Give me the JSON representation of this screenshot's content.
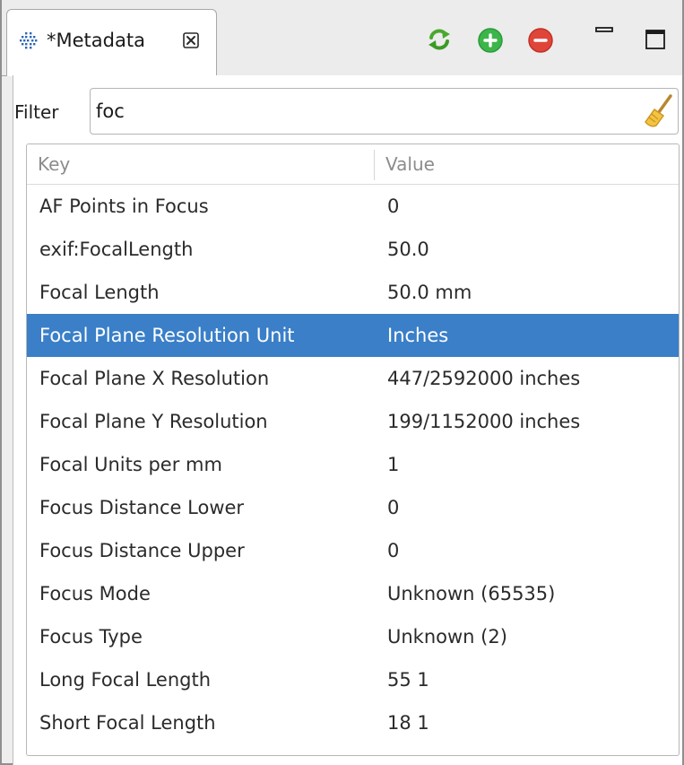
{
  "tab": {
    "title": "*Metadata",
    "icon": "metadata-grid-icon"
  },
  "toolbar": {
    "refresh_icon": "refresh-icon",
    "add_icon": "add-icon",
    "remove_icon": "remove-icon",
    "minimize_icon": "minimize-icon",
    "maximize_icon": "maximize-icon"
  },
  "filter": {
    "label": "Filter",
    "value": "foc",
    "clear_icon": "broom-clear-icon"
  },
  "table": {
    "columns": [
      "Key",
      "Value"
    ],
    "selected_index": 3,
    "rows": [
      {
        "key": "AF Points in Focus",
        "value": "0"
      },
      {
        "key": "exif:FocalLength",
        "value": "50.0"
      },
      {
        "key": "Focal Length",
        "value": "50.0 mm"
      },
      {
        "key": "Focal Plane Resolution Unit",
        "value": "Inches"
      },
      {
        "key": "Focal Plane X Resolution",
        "value": "447/2592000 inches"
      },
      {
        "key": "Focal Plane Y Resolution",
        "value": "199/1152000 inches"
      },
      {
        "key": "Focal Units per mm",
        "value": "1"
      },
      {
        "key": "Focus Distance Lower",
        "value": "0"
      },
      {
        "key": "Focus Distance Upper",
        "value": "0"
      },
      {
        "key": "Focus Mode",
        "value": "Unknown (65535)"
      },
      {
        "key": "Focus Type",
        "value": "Unknown (2)"
      },
      {
        "key": "Long Focal Length",
        "value": "55 1"
      },
      {
        "key": "Short Focal Length",
        "value": "18 1"
      }
    ]
  },
  "colors": {
    "selection": "#3a7fc8",
    "add_green": "#3cb64a",
    "remove_red": "#e0453a",
    "refresh_green": "#4aa82f"
  }
}
